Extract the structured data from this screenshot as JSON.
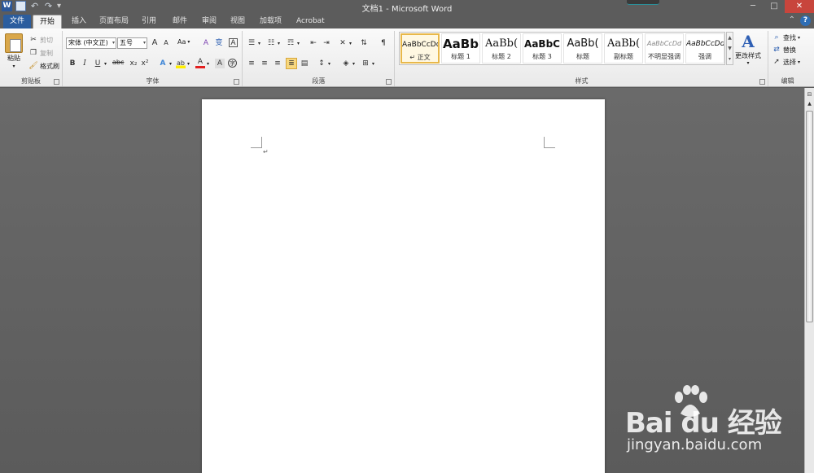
{
  "titlebar": {
    "title": "文档1 - Microsoft Word",
    "app_icon_letter": "W",
    "min_glyph": "─",
    "max_glyph": "□",
    "close_glyph": "✕"
  },
  "tabs": {
    "file": "文件",
    "items": [
      "开始",
      "插入",
      "页面布局",
      "引用",
      "邮件",
      "审阅",
      "视图",
      "加载项",
      "Acrobat"
    ],
    "active_index": 0,
    "help_glyph": "?"
  },
  "clipboard": {
    "label": "剪贴板",
    "paste": "粘贴",
    "cut": "剪切",
    "copy": "复制",
    "format_painter": "格式刷"
  },
  "font": {
    "label": "字体",
    "font_name": "宋体 (中文正)",
    "font_size": "五号",
    "grow": "A",
    "shrink": "A",
    "change_case": "Aa",
    "clear": "A",
    "phonetic": "变",
    "border_char": "A",
    "bold": "B",
    "italic": "I",
    "underline": "U",
    "strikethrough": "abc",
    "subscript": "x₂",
    "superscript": "x²",
    "text_effects": "A",
    "highlight": "ab",
    "font_color": "A",
    "char_shading": "A",
    "enclose": "字"
  },
  "paragraph": {
    "label": "段落"
  },
  "styles": {
    "label": "样式",
    "items": [
      {
        "sample": "AaBbCcDd",
        "label": "↵ 正文"
      },
      {
        "sample": "AaBb",
        "label": "标题 1"
      },
      {
        "sample": "AaBb(",
        "label": "标题 2"
      },
      {
        "sample": "AaBbC",
        "label": "标题 3"
      },
      {
        "sample": "AaBb(",
        "label": "标题"
      },
      {
        "sample": "AaBb(",
        "label": "副标题"
      },
      {
        "sample": "AaBbCcDd",
        "label": "不明显强调"
      },
      {
        "sample": "AaBbCcDd",
        "label": "强调"
      }
    ],
    "selected_index": 0,
    "change_styles": "更改样式"
  },
  "editing": {
    "label": "编辑",
    "find": "查找",
    "replace": "替换",
    "select": "选择"
  },
  "document": {
    "paragraph_mark": "↵"
  },
  "watermark": {
    "brand": "Bai  du 经验",
    "url": "jingyan.baidu.com"
  }
}
